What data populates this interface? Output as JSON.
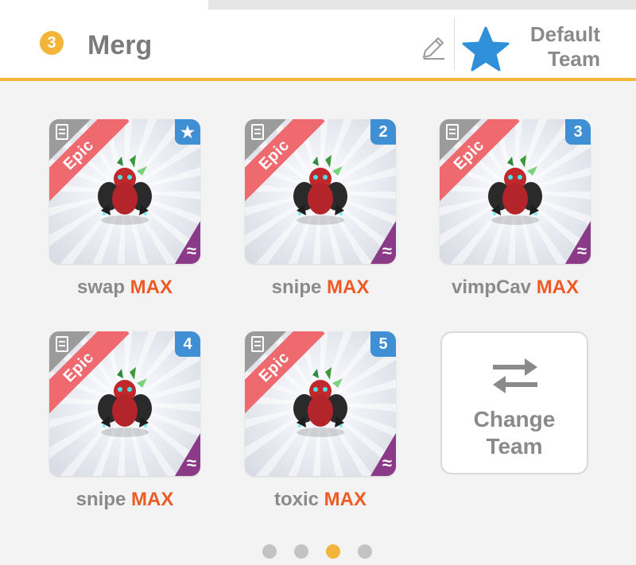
{
  "header": {
    "badge_number": "3",
    "team_name": "Merg",
    "default_line1": "Default",
    "default_line2": "Team",
    "edit_icon": "pencil-icon",
    "star_icon": "star-icon"
  },
  "cards": [
    {
      "rarity": "Epic",
      "corner": "★",
      "corner_icon": "star-icon",
      "element_icon": "wave-icon",
      "name": "swap",
      "level": "MAX"
    },
    {
      "rarity": "Epic",
      "corner": "2",
      "element_icon": "wave-icon",
      "name": "snipe",
      "level": "MAX"
    },
    {
      "rarity": "Epic",
      "corner": "3",
      "element_icon": "wave-icon",
      "name": "vimpCav",
      "level": "MAX"
    },
    {
      "rarity": "Epic",
      "corner": "4",
      "element_icon": "wave-icon",
      "name": "snipe",
      "level": "MAX"
    },
    {
      "rarity": "Epic",
      "corner": "5",
      "element_icon": "wave-icon",
      "name": "toxic",
      "level": "MAX"
    }
  ],
  "change_team": {
    "line1": "Change",
    "line2": "Team",
    "icon": "swap-arrows-icon"
  },
  "pagination": {
    "total": 4,
    "active": 3
  },
  "colors": {
    "accent": "#f2b53a",
    "rarity_epic": "#ef6a6e",
    "slot_blue": "#3f8fd4",
    "element_purple": "#8a3a86",
    "max_orange": "#ee5a24",
    "star_blue": "#2f8fd8"
  }
}
